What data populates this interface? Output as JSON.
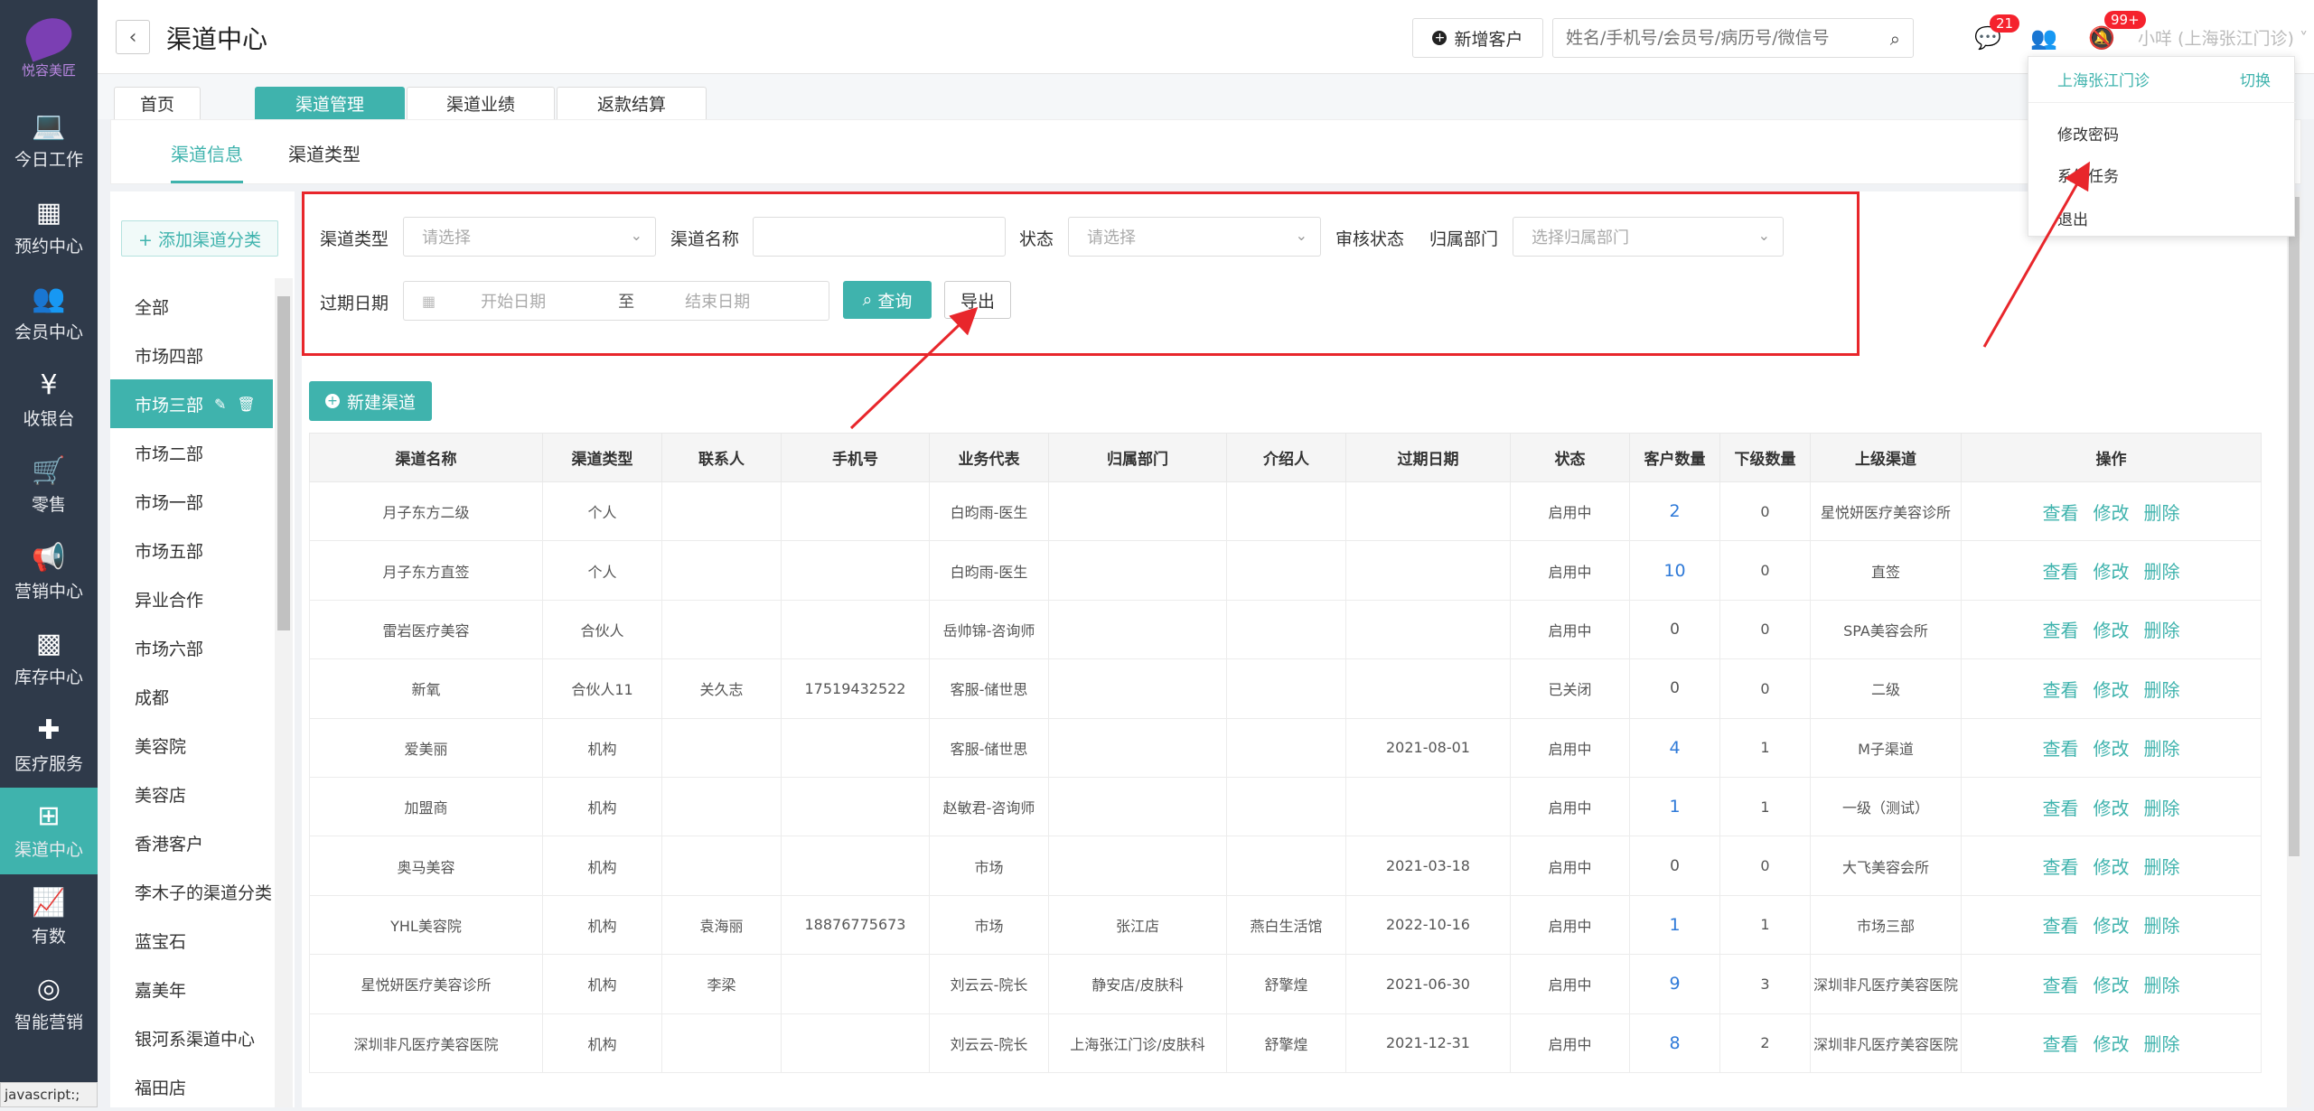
{
  "brand": {
    "logo_text": "悦容美匠"
  },
  "nav": [
    {
      "label": "今日工作",
      "icon": "laptop-icon",
      "glyph": "💻"
    },
    {
      "label": "预约中心",
      "icon": "calendar-icon",
      "glyph": "▦"
    },
    {
      "label": "会员中心",
      "icon": "users-icon",
      "glyph": "👥"
    },
    {
      "label": "收银台",
      "icon": "yen-icon",
      "glyph": "¥"
    },
    {
      "label": "零售",
      "icon": "cart-icon",
      "glyph": "🛒"
    },
    {
      "label": "营销中心",
      "icon": "megaphone-icon",
      "glyph": "📢"
    },
    {
      "label": "库存中心",
      "icon": "grid-icon",
      "glyph": "▩"
    },
    {
      "label": "医疗服务",
      "icon": "medkit-icon",
      "glyph": "✚"
    },
    {
      "label": "渠道中心",
      "icon": "sitemap-icon",
      "glyph": "⊞"
    },
    {
      "label": "有数",
      "icon": "chart-line-icon",
      "glyph": "📈"
    },
    {
      "label": "智能营销",
      "icon": "brain-icon",
      "glyph": "◎"
    }
  ],
  "header": {
    "title": "渠道中心",
    "new_customer_label": "新增客户",
    "search_placeholder": "姓名/手机号/会员号/病历号/微信号",
    "badge_chat": "21",
    "badge_notify": "99+",
    "user_name": "小咩 (上海张江门诊) ˅"
  },
  "tabs": [
    "首页",
    "渠道管理",
    "渠道业绩",
    "返款结算"
  ],
  "subtabs": [
    "渠道信息",
    "渠道类型"
  ],
  "categories": {
    "add_label": "+ 添加渠道分类",
    "items": [
      "全部",
      "市场四部",
      "市场三部",
      "市场二部",
      "市场一部",
      "市场五部",
      "异业合作",
      "市场六部",
      "成都",
      "美容院",
      "美容店",
      "香港客户",
      "李木子的渠道分类",
      "蓝宝石",
      "嘉美年",
      "银河系渠道中心",
      "福田店"
    ]
  },
  "filters": {
    "channel_type_label": "渠道类型",
    "channel_type_placeholder": "请选择",
    "channel_name_label": "渠道名称",
    "status_label": "状态",
    "status_placeholder": "请选择",
    "audit_label": "审核状态",
    "dept_label": "归属部门",
    "dept_placeholder": "选择归属部门",
    "expire_label": "过期日期",
    "start_placeholder": "开始日期",
    "to_label": "至",
    "end_placeholder": "结束日期",
    "query_label": "查询",
    "export_label": "导出"
  },
  "new_channel_label": "新建渠道",
  "table": {
    "headers": [
      "渠道名称",
      "渠道类型",
      "联系人",
      "手机号",
      "业务代表",
      "归属部门",
      "介绍人",
      "过期日期",
      "状态",
      "客户数量",
      "下级数量",
      "上级渠道",
      "操作"
    ],
    "actions": [
      "查看",
      "修改",
      "删除"
    ],
    "rows": [
      [
        "月子东方二级",
        "个人",
        "",
        "",
        "白昀雨-医生",
        "",
        "",
        "",
        "启用中",
        "2",
        "0",
        "星悦妍医疗美容诊所"
      ],
      [
        "月子东方直签",
        "个人",
        "",
        "",
        "白昀雨-医生",
        "",
        "",
        "",
        "启用中",
        "10",
        "0",
        "直签"
      ],
      [
        "雷岩医疗美容",
        "合伙人",
        "",
        "",
        "岳帅锦-咨询师",
        "",
        "",
        "",
        "启用中",
        "0",
        "0",
        "SPA美容会所"
      ],
      [
        "新氧",
        "合伙人11",
        "关久志",
        "17519432522",
        "客服-储世思",
        "",
        "",
        "",
        "已关闭",
        "0",
        "0",
        "二级"
      ],
      [
        "爱美丽",
        "机构",
        "",
        "",
        "客服-储世思",
        "",
        "",
        "2021-08-01",
        "启用中",
        "4",
        "1",
        "M子渠道"
      ],
      [
        "加盟商",
        "机构",
        "",
        "",
        "赵敏君-咨询师",
        "",
        "",
        "",
        "启用中",
        "1",
        "1",
        "一级（测试）"
      ],
      [
        "奥马美容",
        "机构",
        "",
        "",
        "市场",
        "",
        "",
        "2021-03-18",
        "启用中",
        "0",
        "0",
        "大飞美容会所"
      ],
      [
        "YHL美容院",
        "机构",
        "袁海丽",
        "18876775673",
        "市场",
        "张江店",
        "燕白生活馆",
        "2022-10-16",
        "启用中",
        "1",
        "1",
        "市场三部"
      ],
      [
        "星悦妍医疗美容诊所",
        "机构",
        "李梁",
        "",
        "刘云云-院长",
        "静安店/皮肤科",
        "舒擎煌",
        "2021-06-30",
        "启用中",
        "9",
        "3",
        "深圳非凡医疗美容医院"
      ],
      [
        "深圳非凡医疗美容医院",
        "机构",
        "",
        "",
        "刘云云-院长",
        "上海张江门诊/皮肤科",
        "舒擎煌",
        "2021-12-31",
        "启用中",
        "8",
        "2",
        "深圳非凡医疗美容医院"
      ]
    ]
  },
  "dropdown": {
    "branch": "上海张江门诊",
    "switch": "切换",
    "items": [
      "修改密码",
      "系统任务",
      "退出"
    ]
  },
  "statusbar": "javascript:;",
  "colors": {
    "accent": "#3fb3ad",
    "sidebar": "#2f3a4a",
    "annotation": "#e8262b",
    "link": "#2f7ad8"
  }
}
